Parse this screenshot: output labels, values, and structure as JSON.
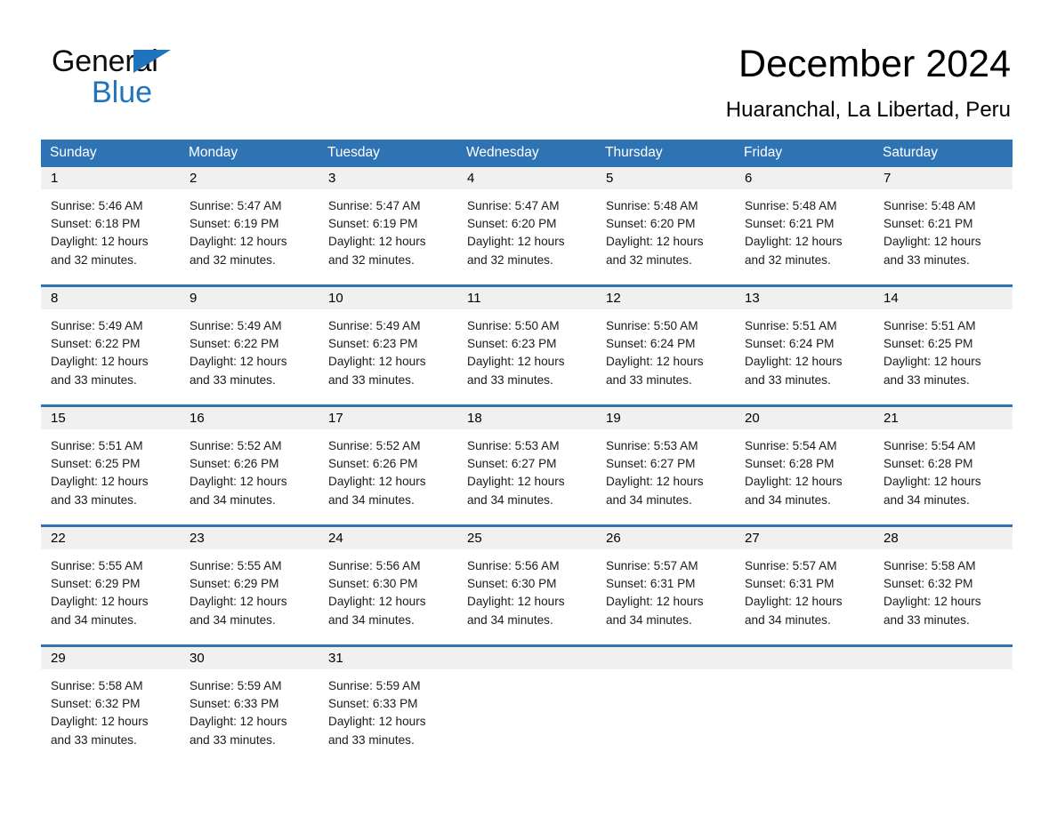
{
  "brand": {
    "line1": "General",
    "line2": "Blue",
    "accent_color": "#1f74bd"
  },
  "header": {
    "title": "December 2024",
    "location": "Huaranchal, La Libertad, Peru"
  },
  "calendar": {
    "header_color": "#2e74b5",
    "daynum_band_color": "#f0f0f0",
    "weekdays": [
      "Sunday",
      "Monday",
      "Tuesday",
      "Wednesday",
      "Thursday",
      "Friday",
      "Saturday"
    ],
    "weeks": [
      [
        {
          "day": "1",
          "sunrise": "Sunrise: 5:46 AM",
          "sunset": "Sunset: 6:18 PM",
          "daylight_1": "Daylight: 12 hours",
          "daylight_2": "and 32 minutes."
        },
        {
          "day": "2",
          "sunrise": "Sunrise: 5:47 AM",
          "sunset": "Sunset: 6:19 PM",
          "daylight_1": "Daylight: 12 hours",
          "daylight_2": "and 32 minutes."
        },
        {
          "day": "3",
          "sunrise": "Sunrise: 5:47 AM",
          "sunset": "Sunset: 6:19 PM",
          "daylight_1": "Daylight: 12 hours",
          "daylight_2": "and 32 minutes."
        },
        {
          "day": "4",
          "sunrise": "Sunrise: 5:47 AM",
          "sunset": "Sunset: 6:20 PM",
          "daylight_1": "Daylight: 12 hours",
          "daylight_2": "and 32 minutes."
        },
        {
          "day": "5",
          "sunrise": "Sunrise: 5:48 AM",
          "sunset": "Sunset: 6:20 PM",
          "daylight_1": "Daylight: 12 hours",
          "daylight_2": "and 32 minutes."
        },
        {
          "day": "6",
          "sunrise": "Sunrise: 5:48 AM",
          "sunset": "Sunset: 6:21 PM",
          "daylight_1": "Daylight: 12 hours",
          "daylight_2": "and 32 minutes."
        },
        {
          "day": "7",
          "sunrise": "Sunrise: 5:48 AM",
          "sunset": "Sunset: 6:21 PM",
          "daylight_1": "Daylight: 12 hours",
          "daylight_2": "and 33 minutes."
        }
      ],
      [
        {
          "day": "8",
          "sunrise": "Sunrise: 5:49 AM",
          "sunset": "Sunset: 6:22 PM",
          "daylight_1": "Daylight: 12 hours",
          "daylight_2": "and 33 minutes."
        },
        {
          "day": "9",
          "sunrise": "Sunrise: 5:49 AM",
          "sunset": "Sunset: 6:22 PM",
          "daylight_1": "Daylight: 12 hours",
          "daylight_2": "and 33 minutes."
        },
        {
          "day": "10",
          "sunrise": "Sunrise: 5:49 AM",
          "sunset": "Sunset: 6:23 PM",
          "daylight_1": "Daylight: 12 hours",
          "daylight_2": "and 33 minutes."
        },
        {
          "day": "11",
          "sunrise": "Sunrise: 5:50 AM",
          "sunset": "Sunset: 6:23 PM",
          "daylight_1": "Daylight: 12 hours",
          "daylight_2": "and 33 minutes."
        },
        {
          "day": "12",
          "sunrise": "Sunrise: 5:50 AM",
          "sunset": "Sunset: 6:24 PM",
          "daylight_1": "Daylight: 12 hours",
          "daylight_2": "and 33 minutes."
        },
        {
          "day": "13",
          "sunrise": "Sunrise: 5:51 AM",
          "sunset": "Sunset: 6:24 PM",
          "daylight_1": "Daylight: 12 hours",
          "daylight_2": "and 33 minutes."
        },
        {
          "day": "14",
          "sunrise": "Sunrise: 5:51 AM",
          "sunset": "Sunset: 6:25 PM",
          "daylight_1": "Daylight: 12 hours",
          "daylight_2": "and 33 minutes."
        }
      ],
      [
        {
          "day": "15",
          "sunrise": "Sunrise: 5:51 AM",
          "sunset": "Sunset: 6:25 PM",
          "daylight_1": "Daylight: 12 hours",
          "daylight_2": "and 33 minutes."
        },
        {
          "day": "16",
          "sunrise": "Sunrise: 5:52 AM",
          "sunset": "Sunset: 6:26 PM",
          "daylight_1": "Daylight: 12 hours",
          "daylight_2": "and 34 minutes."
        },
        {
          "day": "17",
          "sunrise": "Sunrise: 5:52 AM",
          "sunset": "Sunset: 6:26 PM",
          "daylight_1": "Daylight: 12 hours",
          "daylight_2": "and 34 minutes."
        },
        {
          "day": "18",
          "sunrise": "Sunrise: 5:53 AM",
          "sunset": "Sunset: 6:27 PM",
          "daylight_1": "Daylight: 12 hours",
          "daylight_2": "and 34 minutes."
        },
        {
          "day": "19",
          "sunrise": "Sunrise: 5:53 AM",
          "sunset": "Sunset: 6:27 PM",
          "daylight_1": "Daylight: 12 hours",
          "daylight_2": "and 34 minutes."
        },
        {
          "day": "20",
          "sunrise": "Sunrise: 5:54 AM",
          "sunset": "Sunset: 6:28 PM",
          "daylight_1": "Daylight: 12 hours",
          "daylight_2": "and 34 minutes."
        },
        {
          "day": "21",
          "sunrise": "Sunrise: 5:54 AM",
          "sunset": "Sunset: 6:28 PM",
          "daylight_1": "Daylight: 12 hours",
          "daylight_2": "and 34 minutes."
        }
      ],
      [
        {
          "day": "22",
          "sunrise": "Sunrise: 5:55 AM",
          "sunset": "Sunset: 6:29 PM",
          "daylight_1": "Daylight: 12 hours",
          "daylight_2": "and 34 minutes."
        },
        {
          "day": "23",
          "sunrise": "Sunrise: 5:55 AM",
          "sunset": "Sunset: 6:29 PM",
          "daylight_1": "Daylight: 12 hours",
          "daylight_2": "and 34 minutes."
        },
        {
          "day": "24",
          "sunrise": "Sunrise: 5:56 AM",
          "sunset": "Sunset: 6:30 PM",
          "daylight_1": "Daylight: 12 hours",
          "daylight_2": "and 34 minutes."
        },
        {
          "day": "25",
          "sunrise": "Sunrise: 5:56 AM",
          "sunset": "Sunset: 6:30 PM",
          "daylight_1": "Daylight: 12 hours",
          "daylight_2": "and 34 minutes."
        },
        {
          "day": "26",
          "sunrise": "Sunrise: 5:57 AM",
          "sunset": "Sunset: 6:31 PM",
          "daylight_1": "Daylight: 12 hours",
          "daylight_2": "and 34 minutes."
        },
        {
          "day": "27",
          "sunrise": "Sunrise: 5:57 AM",
          "sunset": "Sunset: 6:31 PM",
          "daylight_1": "Daylight: 12 hours",
          "daylight_2": "and 34 minutes."
        },
        {
          "day": "28",
          "sunrise": "Sunrise: 5:58 AM",
          "sunset": "Sunset: 6:32 PM",
          "daylight_1": "Daylight: 12 hours",
          "daylight_2": "and 33 minutes."
        }
      ],
      [
        {
          "day": "29",
          "sunrise": "Sunrise: 5:58 AM",
          "sunset": "Sunset: 6:32 PM",
          "daylight_1": "Daylight: 12 hours",
          "daylight_2": "and 33 minutes."
        },
        {
          "day": "30",
          "sunrise": "Sunrise: 5:59 AM",
          "sunset": "Sunset: 6:33 PM",
          "daylight_1": "Daylight: 12 hours",
          "daylight_2": "and 33 minutes."
        },
        {
          "day": "31",
          "sunrise": "Sunrise: 5:59 AM",
          "sunset": "Sunset: 6:33 PM",
          "daylight_1": "Daylight: 12 hours",
          "daylight_2": "and 33 minutes."
        },
        {
          "day": "",
          "sunrise": "",
          "sunset": "",
          "daylight_1": "",
          "daylight_2": ""
        },
        {
          "day": "",
          "sunrise": "",
          "sunset": "",
          "daylight_1": "",
          "daylight_2": ""
        },
        {
          "day": "",
          "sunrise": "",
          "sunset": "",
          "daylight_1": "",
          "daylight_2": ""
        },
        {
          "day": "",
          "sunrise": "",
          "sunset": "",
          "daylight_1": "",
          "daylight_2": ""
        }
      ]
    ]
  }
}
